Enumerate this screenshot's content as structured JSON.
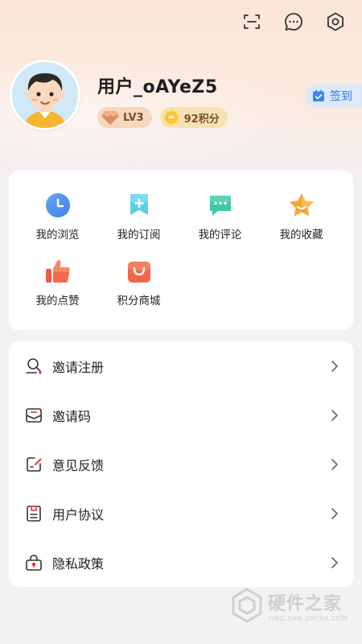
{
  "header": {
    "scan_icon": "scan-icon",
    "message_icon": "message-icon",
    "settings_icon": "settings-icon"
  },
  "profile": {
    "username": "用户_oAYeZ5",
    "level": "LV3",
    "points": "92积分",
    "signin_label": "签到"
  },
  "features": [
    {
      "label": "我的浏览",
      "icon": "history-icon",
      "color": "#4a8ef0"
    },
    {
      "label": "我的订阅",
      "icon": "subscribe-icon",
      "color": "#5ed0e6"
    },
    {
      "label": "我的评论",
      "icon": "comment-icon",
      "color": "#3ec9a7"
    },
    {
      "label": "我的收藏",
      "icon": "star-icon",
      "color": "#f7a531"
    },
    {
      "label": "我的点赞",
      "icon": "thumbs-up-icon",
      "color": "#f05a45"
    },
    {
      "label": "积分商城",
      "icon": "shopping-bag-icon",
      "color": "#f26548"
    }
  ],
  "menu": [
    {
      "label": "邀请注册",
      "icon": "invite-user-icon"
    },
    {
      "label": "邀请码",
      "icon": "envelope-icon"
    },
    {
      "label": "意见反馈",
      "icon": "feedback-icon"
    },
    {
      "label": "用户协议",
      "icon": "agreement-icon"
    },
    {
      "label": "隐私政策",
      "icon": "privacy-lock-icon"
    }
  ],
  "watermark": {
    "cn": "硬件之家",
    "en": "YING JIAN ZHI JIA.COM"
  }
}
